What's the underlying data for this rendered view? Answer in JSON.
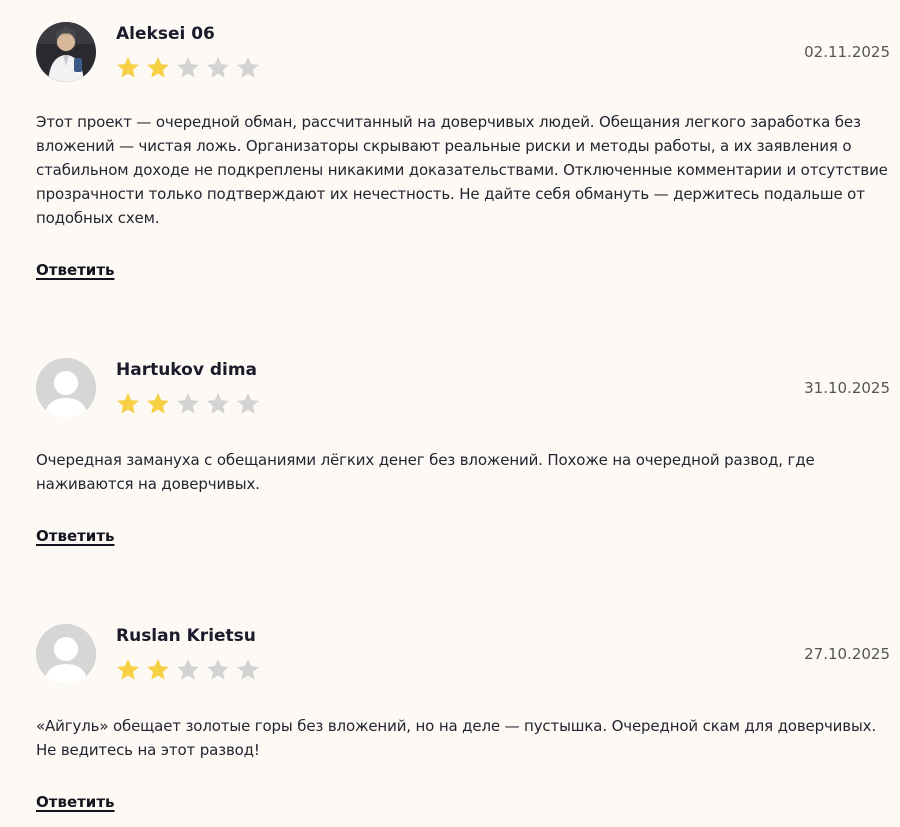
{
  "reviews": [
    {
      "author": "Aleksei 06",
      "date": "02.11.2025",
      "rating": 2,
      "max_rating": 5,
      "avatar": "user-photo",
      "text": "Этот проект — очередной обман, рассчитанный на доверчивых людей. Обещания легкого заработка без вложений — чистая ложь. Организаторы скрывают реальные риски и методы работы, а их заявления о стабильном доходе не подкреплены никакими доказательствами. Отключенные комментарии и отсутствие прозрачности только подтверждают их нечестность. Не дайте себя обмануть — держитесь подальше от подобных схем.",
      "reply_label": "Ответить"
    },
    {
      "author": "Hartukov dima",
      "date": "31.10.2025",
      "rating": 2,
      "max_rating": 5,
      "avatar": "default-avatar",
      "text": "Очередная замануха с обещаниями лёгких денег без вложений. Похоже на очередной развод, где наживаются на доверчивых.",
      "reply_label": "Ответить"
    },
    {
      "author": "Ruslan Krietsu",
      "date": "27.10.2025",
      "rating": 2,
      "max_rating": 5,
      "avatar": "default-avatar",
      "text": "«Айгуль» обещает золотые горы без вложений, но на деле — пустышка. Очередной скам для доверчивых. Не ведитесь на этот развод!",
      "reply_label": "Ответить"
    }
  ],
  "colors": {
    "background": "#fdfaf6",
    "star_filled": "#f7d046",
    "star_empty": "#d3d3d3",
    "avatar_placeholder": "#d6d6d6"
  }
}
